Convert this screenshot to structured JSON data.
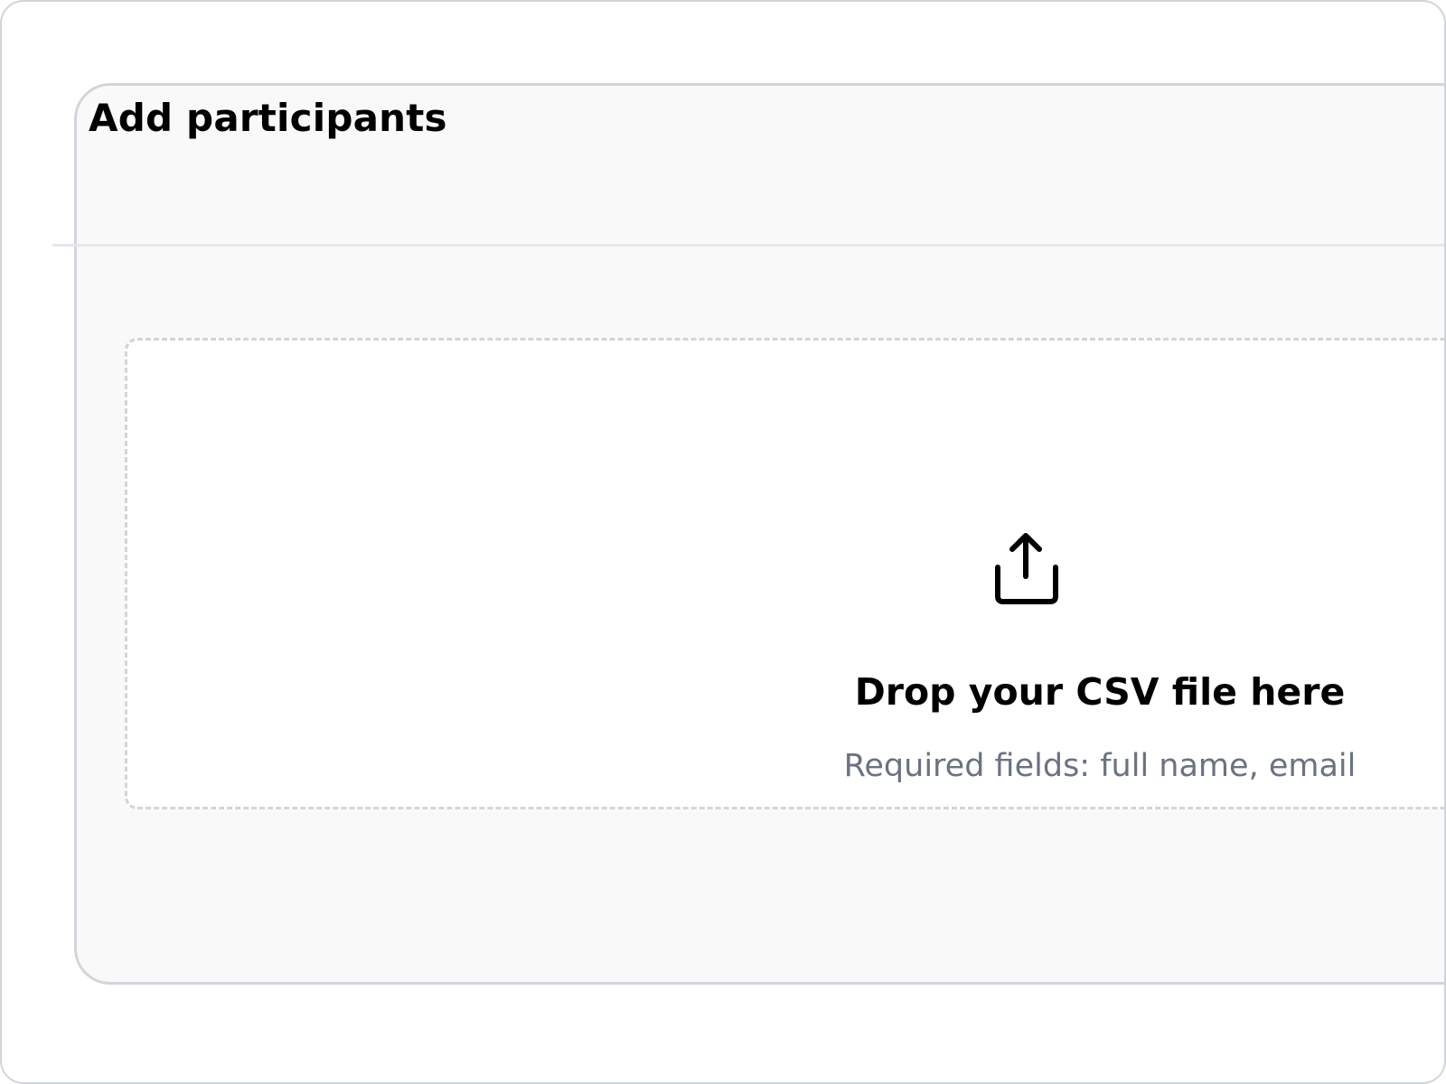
{
  "dialog": {
    "title": "Add participants"
  },
  "dropzone": {
    "icon": "upload-icon",
    "title": "Drop your CSV file here",
    "hint": "Required fields: full name, email"
  },
  "colors": {
    "border": "#d1d5db",
    "panel_bg": "#f9f9f9",
    "hint_text": "#6b7280",
    "text": "#000000"
  }
}
